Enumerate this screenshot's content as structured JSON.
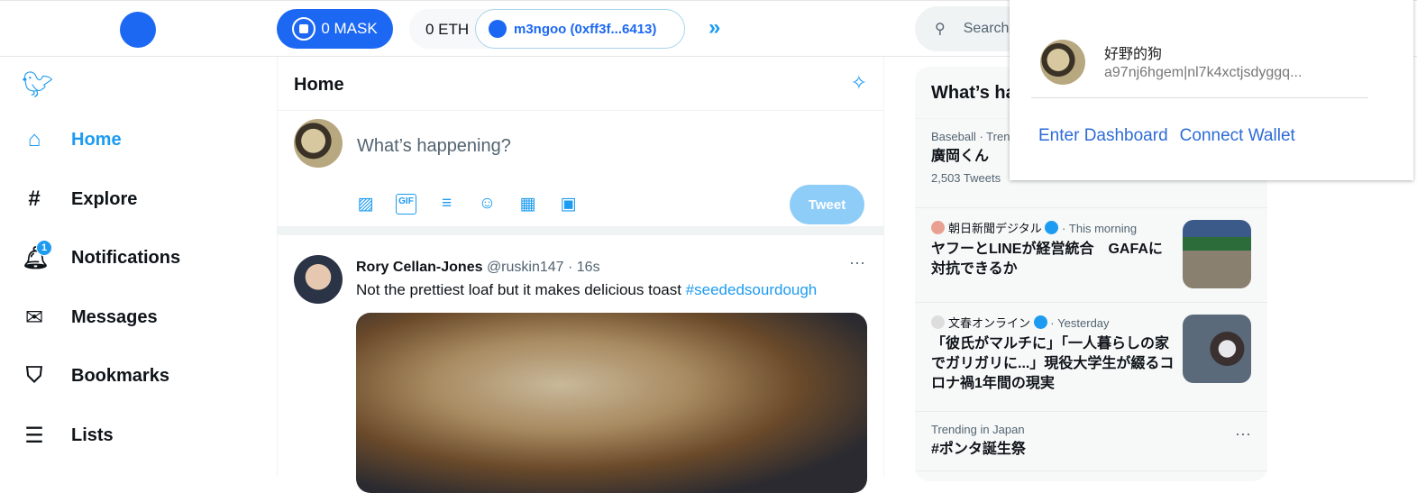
{
  "topbar": {
    "mask_balance": "0 MASK",
    "eth_balance": "0 ETH",
    "account": "m3ngoo (0xff3f...6413)",
    "search_placeholder": "Search Twitter"
  },
  "sidebar": {
    "items": [
      {
        "label": "Home",
        "icon": "home-icon",
        "active": true
      },
      {
        "label": "Explore",
        "icon": "hashtag-icon"
      },
      {
        "label": "Notifications",
        "icon": "bell-icon",
        "badge": "1"
      },
      {
        "label": "Messages",
        "icon": "mail-icon"
      },
      {
        "label": "Bookmarks",
        "icon": "bookmark-icon"
      },
      {
        "label": "Lists",
        "icon": "list-icon"
      }
    ]
  },
  "main": {
    "title": "Home",
    "compose_placeholder": "What’s happening?",
    "tweet_button": "Tweet",
    "tweet": {
      "name": "Rory Cellan-Jones",
      "handle": "@ruskin147 · 16s",
      "text": "Not the prettiest loaf but it makes delicious toast ",
      "hashtag": "#seededsourdough"
    }
  },
  "trends": {
    "title": "What’s happening",
    "items": [
      {
        "meta": "Baseball · Trending",
        "title": "廣岡くん",
        "count": "2,503 Tweets"
      },
      {
        "source": "朝日新聞デジタル",
        "meta": " · This morning",
        "title": "ヤフーとLINEが経営統合　GAFAに対抗できるか"
      },
      {
        "source": "文春オンライン",
        "meta": " · Yesterday",
        "title": "「彼氏がマルチに」「一人暮らしの家でガリガリに...」現役大学生が綴るコロナ禍1年間の現実"
      },
      {
        "meta": "Trending in Japan",
        "title": "#ポンタ誕生祭"
      }
    ]
  },
  "popup": {
    "persona_name": "好野的狗",
    "persona_id": "a97nj6hgem|nl7k4xctjsdyggq...",
    "enter_dashboard": "Enter Dashboard",
    "connect_wallet": "Connect Wallet"
  },
  "colors": {
    "accent": "#1d9bf0",
    "mask_blue": "#1c68f3"
  }
}
